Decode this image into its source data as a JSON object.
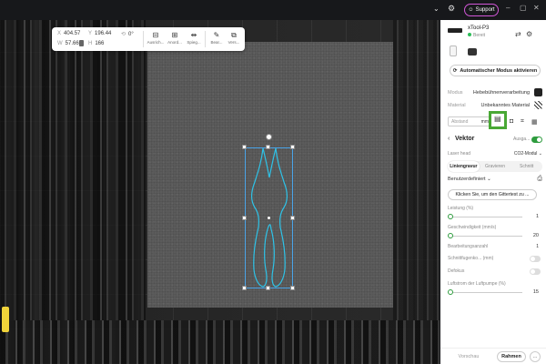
{
  "topbar": {
    "support_label": "Support",
    "icons": [
      "chevron-down-icon",
      "gear-icon",
      "support-icon",
      "minimize-icon",
      "maximize-icon",
      "close-icon"
    ]
  },
  "toolbar": {
    "x_label": "X",
    "x_value": "404.57",
    "y_label": "Y",
    "y_value": "196.44",
    "rotation_value": "0°",
    "w_label": "W",
    "w_value": "57.66",
    "h_label": "H",
    "h_value": "166",
    "tools": [
      {
        "icon": "align-icon",
        "label": "Ausrich..."
      },
      {
        "icon": "arrange-icon",
        "label": "Anord..."
      },
      {
        "icon": "mirror-icon",
        "label": "Spieg..."
      },
      {
        "icon": "edit-icon",
        "label": "Bear..."
      },
      {
        "icon": "merge-icon",
        "label": "Vers..."
      }
    ]
  },
  "panel": {
    "device_name": "xTool-P3",
    "device_status": "Bereit",
    "auto_button": "Automatischer Modus aktivieren",
    "modus_label": "Modus",
    "modus_value": "Hebebühnenverarbeitung",
    "material_label": "Material",
    "material_value": "Unbekanntes Material",
    "abstand_placeholder": "Abstand",
    "abstand_unit": "mm",
    "vektor_title": "Vektor",
    "ausgabe_label": "Ausga...",
    "laserhead_label": "Laser head",
    "laserhead_value": "CO2-Modul",
    "tabs": [
      "Liniengravur",
      "Gravieren",
      "Schnitt"
    ],
    "preset_label": "Benutzerdefiniert",
    "grid_button": "Klicken Sie, um den Gittertest zu ...",
    "leistung_label": "Leistung (%)",
    "leistung_value": "1",
    "geschwindigkeit_label": "Geschwindigkeit (mm/s)",
    "geschwindigkeit_value": "20",
    "bearbeitung_label": "Bearbeitungsanzahl",
    "bearbeitung_value": "1",
    "schnittfugen_label": "Schnittfugenko... (mm)",
    "defokus_label": "Defokus",
    "luftstrom_label": "Luftstrom der Luftpumpe (%)",
    "luftstrom_value": "15",
    "footer_preview": "Vorschau",
    "footer_frame": "Rahmen",
    "footer_more": "..."
  },
  "colors": {
    "accent_green": "#2e9c3e",
    "highlight_box": "#49a835",
    "selection": "#4aa4e8",
    "support_border": "#d257d8"
  }
}
